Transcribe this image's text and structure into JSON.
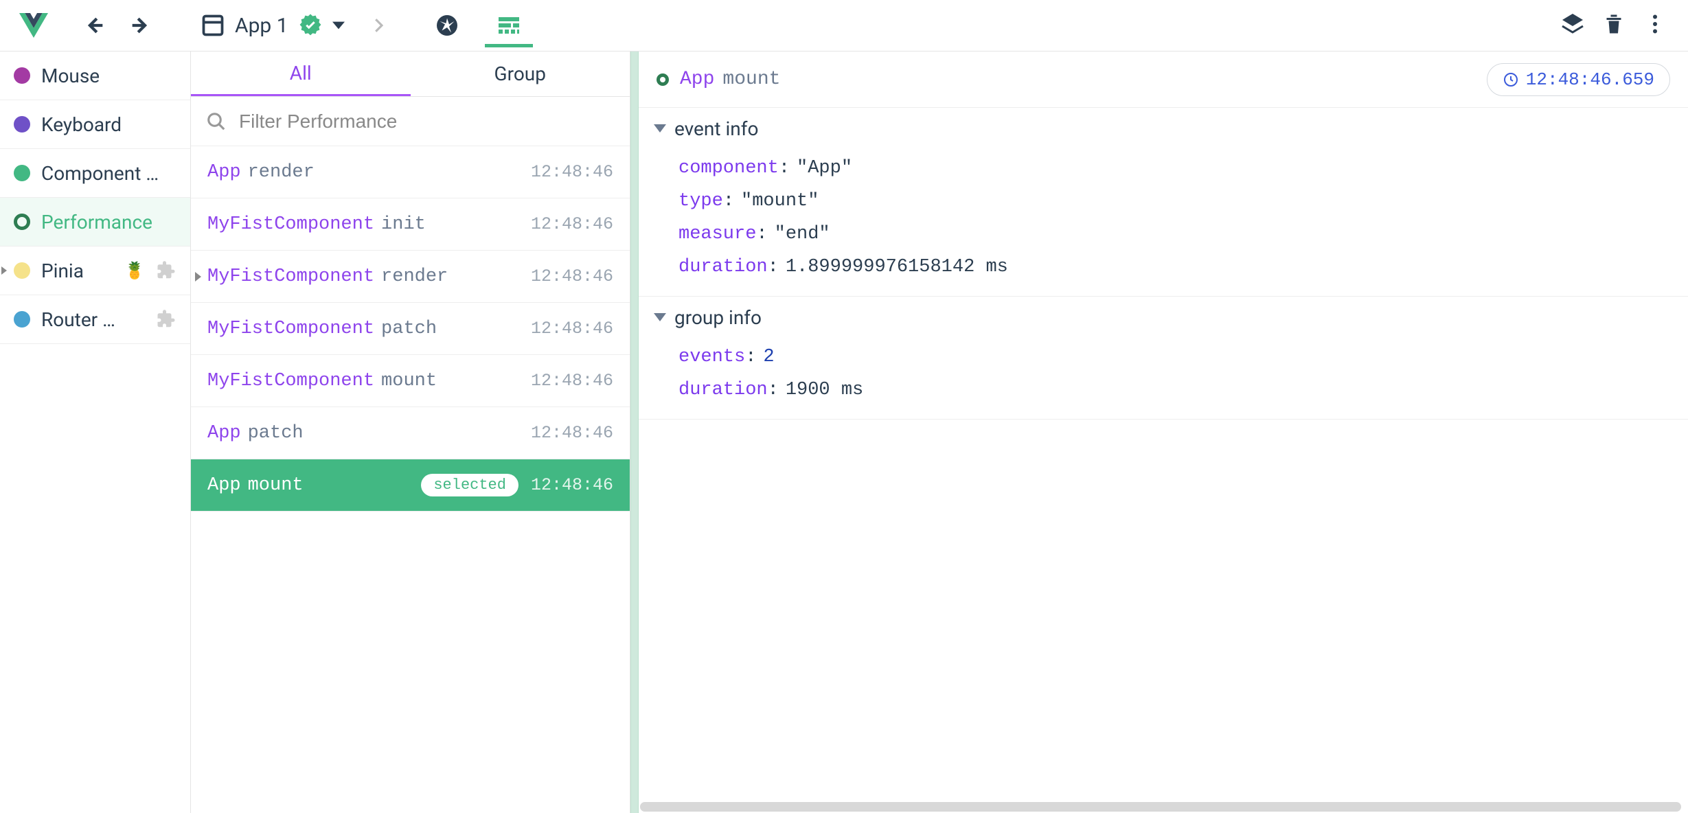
{
  "header": {
    "app_name": "App 1"
  },
  "sidebar": {
    "items": [
      {
        "label": "Mouse",
        "color": "#a33aa3"
      },
      {
        "label": "Keyboard",
        "color": "#6f51c7"
      },
      {
        "label": "Component …",
        "color": "#42b883"
      },
      {
        "label": "Performance",
        "ring": "#2e7d52",
        "active": true
      },
      {
        "label": "Pinia",
        "emoji": "🍍",
        "color": "#f5e28a",
        "puzzle": true,
        "caret": true
      },
      {
        "label": "Router …",
        "color": "#4aa3d1",
        "puzzle": true
      }
    ]
  },
  "subtabs": {
    "all": "All",
    "group": "Group"
  },
  "filter": {
    "placeholder": "Filter Performance"
  },
  "events": [
    {
      "component": "App",
      "action": "render",
      "time": "12:48:46"
    },
    {
      "component": "MyFistComponent",
      "action": "init",
      "time": "12:48:46"
    },
    {
      "component": "MyFistComponent",
      "action": "render",
      "time": "12:48:46",
      "caret": true
    },
    {
      "component": "MyFistComponent",
      "action": "patch",
      "time": "12:48:46"
    },
    {
      "component": "MyFistComponent",
      "action": "mount",
      "time": "12:48:46"
    },
    {
      "component": "App",
      "action": "patch",
      "time": "12:48:46"
    },
    {
      "component": "App",
      "action": "mount",
      "time": "12:48:46",
      "selected": true,
      "badge": "selected"
    }
  ],
  "detail": {
    "title_component": "App",
    "title_action": "mount",
    "timestamp": "12:48:46.659",
    "sections": [
      {
        "title": "event info",
        "rows": [
          {
            "key": "component",
            "type": "str",
            "value": "\"App\""
          },
          {
            "key": "type",
            "type": "str",
            "value": "\"mount\""
          },
          {
            "key": "measure",
            "type": "str",
            "value": "\"end\""
          },
          {
            "key": "duration",
            "type": "num",
            "value": "1.899999976158142 ms"
          }
        ]
      },
      {
        "title": "group info",
        "rows": [
          {
            "key": "events",
            "type": "int",
            "value": "2"
          },
          {
            "key": "duration",
            "type": "num",
            "value": "1900 ms"
          }
        ]
      }
    ]
  }
}
